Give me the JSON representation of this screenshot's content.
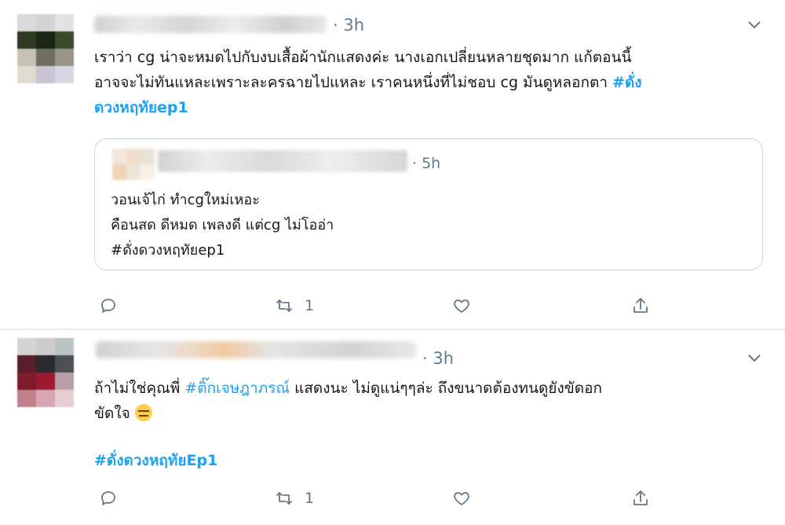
{
  "tweets": [
    {
      "time": "3h",
      "line1": "เราว่า cg น่าจะหมดไปกับงบเสื้อผ้านักแสดงค่ะ นางเอกเปลี่ยนหลายชุดมาก แก้ตอนนี้",
      "line2": "อาจจะไม่ทันแหละเพราะละครฉายไปแหละ เราคนหนึ่งที่ไม่ชอบ cg มันดูหลอกตา ",
      "hashtag_part1": "#ดั่ง",
      "hashtag_part2": "ดวงหฤทัยep1",
      "quote": {
        "time": "5h",
        "line1": "วอนเจ้ไก่ ทำcgใหม่เหอะ",
        "line2": "คือนสด ดีหมด เพลงดี แต่cg ไม่โออ่า",
        "line3": "#ดั่งดวงหฤทัยep1"
      },
      "retweets": "1"
    },
    {
      "time": "3h",
      "line1_before": "ถ้าไม่ใช่คุณพี่ ",
      "line1_hashtag": "#ติ๊กเจษฎาภรณ์",
      "line1_after": " แสดงนะ ไม่ดูแน่ๆๆล่ะ ถึงขนาดต้องทนดูยังขัดอก",
      "line2": "ขัดใจ ",
      "hashtag": "#ดั่งดวงหฤทัยEp1",
      "retweets": "1"
    }
  ],
  "icons": {
    "reply": "reply-icon",
    "retweet": "retweet-icon",
    "like": "like-icon",
    "share": "share-icon",
    "caret": "chevron-down-icon",
    "emoji": "expressionless-face-emoji"
  },
  "colors": {
    "hashtag": "#1da1f2",
    "secondary_text": "#657786",
    "border": "#ccd6dd"
  }
}
